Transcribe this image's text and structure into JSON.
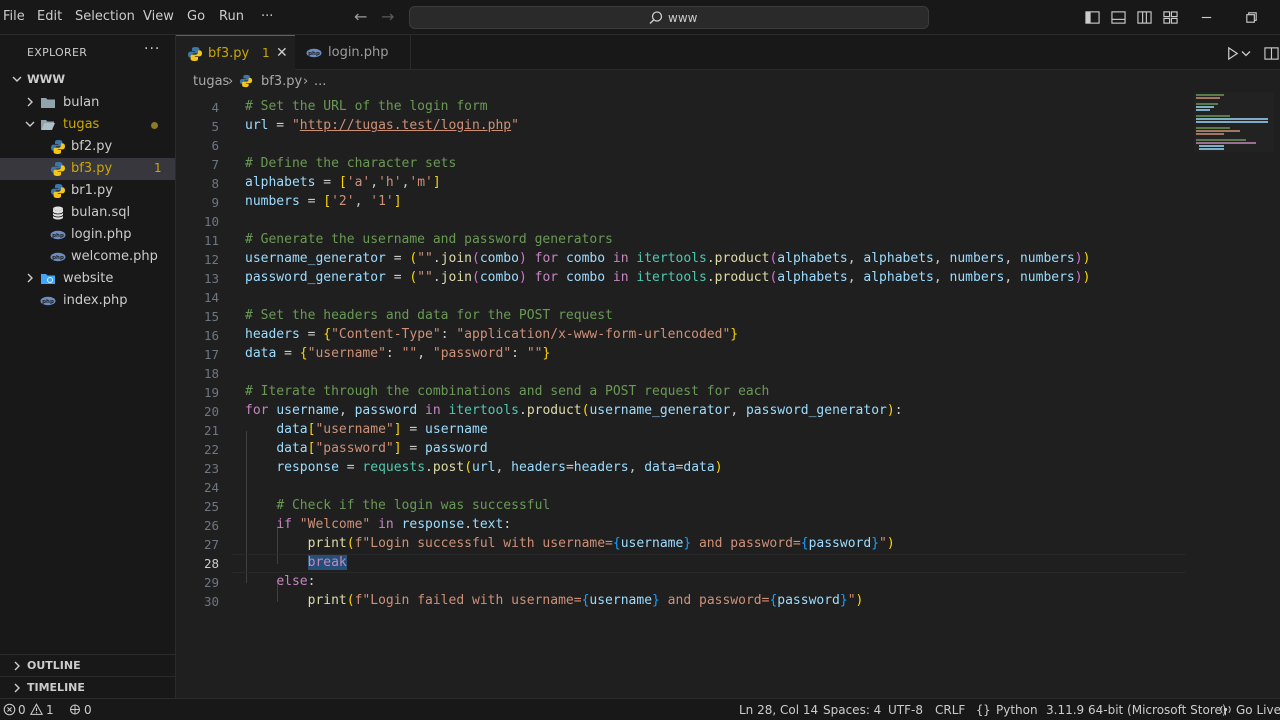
{
  "menu": [
    "File",
    "Edit",
    "Selection",
    "View",
    "Go",
    "Run",
    "···"
  ],
  "search": {
    "text": "www"
  },
  "sidebar": {
    "title": "EXPLORER",
    "more": "···",
    "root": "WWW",
    "items": [
      {
        "label": "bulan",
        "type": "folder"
      },
      {
        "label": "tugas",
        "type": "folder-open"
      },
      {
        "label": "bf2.py",
        "type": "py"
      },
      {
        "label": "bf3.py",
        "type": "py",
        "badge": "1"
      },
      {
        "label": "br1.py",
        "type": "py"
      },
      {
        "label": "bulan.sql",
        "type": "sql"
      },
      {
        "label": "login.php",
        "type": "php"
      },
      {
        "label": "welcome.php",
        "type": "php"
      },
      {
        "label": "website",
        "type": "folder"
      },
      {
        "label": "index.php",
        "type": "php"
      }
    ],
    "outline": "OUTLINE",
    "timeline": "TIMELINE"
  },
  "tabs": [
    {
      "label": "bf3.py",
      "problems": "1",
      "close": "✕"
    },
    {
      "label": "login.php"
    }
  ],
  "breadcrumb": [
    "tugas",
    "bf3.py",
    "..."
  ],
  "editor": {
    "line_numbers": [
      "4",
      "5",
      "6",
      "7",
      "8",
      "9",
      "10",
      "11",
      "12",
      "13",
      "14",
      "15",
      "16",
      "17",
      "18",
      "19",
      "20",
      "21",
      "22",
      "23",
      "24",
      "25",
      "26",
      "27",
      "28",
      "29",
      "30"
    ],
    "current_line": "28"
  },
  "status": {
    "errors": "0",
    "warnings": "1",
    "ports": "0",
    "position": "Ln 28, Col 14",
    "spaces": "Spaces: 4",
    "encoding": "UTF-8",
    "eol": "CRLF",
    "language": "Python",
    "interpreter": "3.11.9 64-bit (Microsoft Store)",
    "golive": "Go Live"
  },
  "colors": {
    "accent": "#0078d4",
    "warning": "#cca700",
    "background": "#1f1f1f",
    "sidebar": "#181818"
  }
}
